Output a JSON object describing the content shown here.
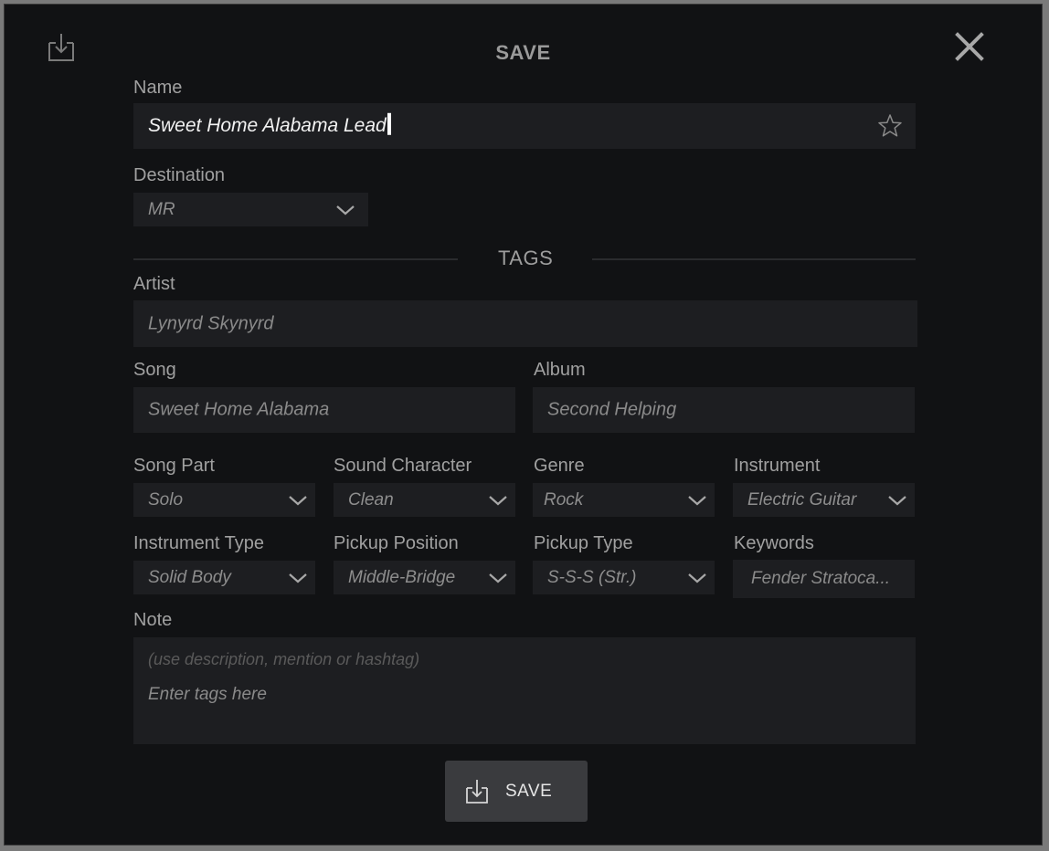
{
  "dialog": {
    "title": "SAVE"
  },
  "name": {
    "label": "Name",
    "value": "Sweet Home Alabama Lead"
  },
  "destination": {
    "label": "Destination",
    "value": "MR"
  },
  "tags": {
    "title": "TAGS",
    "artist": {
      "label": "Artist",
      "value": "Lynyrd Skynyrd"
    },
    "song": {
      "label": "Song",
      "value": "Sweet Home Alabama"
    },
    "album": {
      "label": "Album",
      "value": "Second Helping"
    },
    "song_part": {
      "label": "Song Part",
      "value": "Solo"
    },
    "sound_character": {
      "label": "Sound Character",
      "value": "Clean"
    },
    "genre": {
      "label": "Genre",
      "value": "Rock"
    },
    "instrument": {
      "label": "Instrument",
      "value": "Electric Guitar"
    },
    "instrument_type": {
      "label": "Instrument Type",
      "value": "Solid Body"
    },
    "pickup_position": {
      "label": "Pickup Position",
      "value": "Middle-Bridge"
    },
    "pickup_type": {
      "label": "Pickup Type",
      "value": "S-S-S (Str.)"
    },
    "keywords": {
      "label": "Keywords",
      "value": "Fender Stratoca..."
    }
  },
  "note": {
    "label": "Note",
    "placeholder": "(use description, mention or hashtag)",
    "value": "Enter tags here"
  },
  "save_button": {
    "label": "SAVE"
  },
  "icons": {
    "header": "save-download-icon",
    "close": "close-icon",
    "favorite": "star-outline-icon",
    "dropdown": "chevron-down-icon"
  }
}
